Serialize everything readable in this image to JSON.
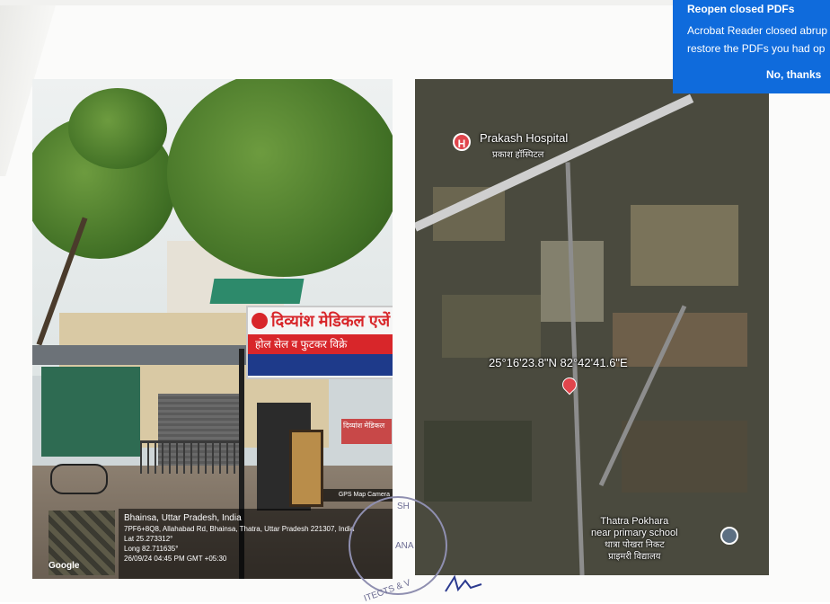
{
  "street_photo": {
    "gps_tag": "GPS Map Camera",
    "location_title": "Bhainsa, Uttar Pradesh, India",
    "address": "7PF6+8Q8, Allahabad Rd, Bhainsa, Thatra, Uttar Pradesh 221307, India",
    "lat": "Lat 25.273312°",
    "long": "Long 82.711635°",
    "datetime": "26/09/24 04:45 PM GMT +05:30",
    "map_brand": "Google",
    "sign_title": "दिव्यांश मेडिकल एजें",
    "sign_subtitle": "होल सेल व फुटकर विक्रे",
    "small_sign": "दिव्यांश मेडिकल"
  },
  "satellite_map": {
    "hospital_name": "Prakash Hospital",
    "hospital_name_hi": "प्रकाश हॉस्पिटल",
    "coordinates": "25°16'23.8\"N 82°42'41.6\"E",
    "school_name": "Thatra Pokhara",
    "school_name_line2": "near primary school",
    "school_name_hi": "थात्रा पोखरा निकट",
    "school_name_hi2": "प्राइमरी विद्यालय"
  },
  "stamp": {
    "text_right": "SH",
    "text_mid": "ANA",
    "text_bottom": "ITECTS & V"
  },
  "notification": {
    "title": "Reopen closed PDFs",
    "body_line1": "Acrobat Reader closed abrup",
    "body_line2": "restore the PDFs you had op",
    "button": "No, thanks",
    "color": "#0f6bdc"
  }
}
